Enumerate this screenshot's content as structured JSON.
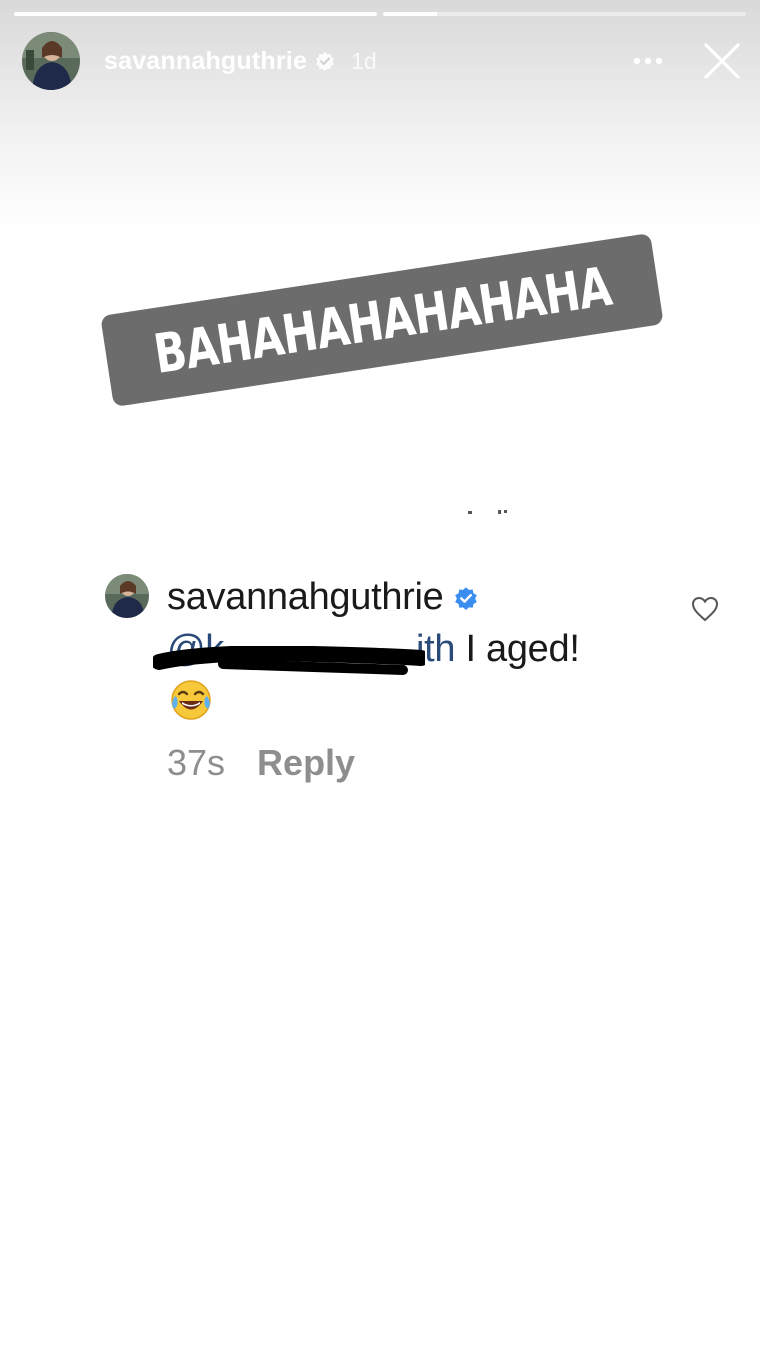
{
  "story": {
    "progress": [
      1.0,
      0.15
    ],
    "username": "savannahguthrie",
    "time_ago": "1d"
  },
  "sticker": {
    "text": "BAHAHAHAHAHAHA"
  },
  "comment": {
    "username": "savannahguthrie",
    "mention": "@kelemerith",
    "mention_visible_start": "@k",
    "mention_visible_end": "ith",
    "text": " I aged!",
    "emoji": "face-with-tears-of-joy",
    "time": "37s",
    "reply_label": "Reply"
  },
  "colors": {
    "verified": "#3b8df0",
    "sticker_bg": "#6c6c6c",
    "mention": "#2a4a7a",
    "meta": "#8e8e8e"
  }
}
